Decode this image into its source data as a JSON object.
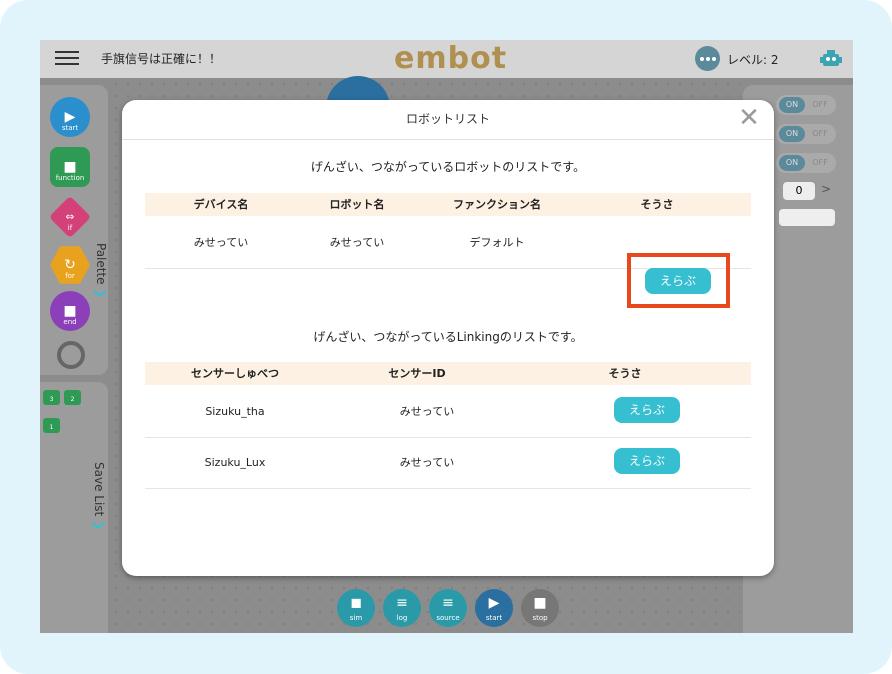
{
  "header": {
    "mission": "手旗信号は正確に！！",
    "logo": "embot",
    "level": "レベル: 2"
  },
  "palette": {
    "tab_label": "Palette",
    "items": [
      {
        "label": "start",
        "color": "#2a8fcc"
      },
      {
        "label": "function",
        "color": "#2e9a54"
      },
      {
        "label": "if",
        "color": "#d4417a"
      },
      {
        "label": "for",
        "color": "#e8a21e"
      },
      {
        "label": "end",
        "color": "#8b3fb8"
      }
    ]
  },
  "save_list": {
    "tab_label": "Save List",
    "slots": [
      "3",
      "2",
      "1"
    ]
  },
  "right_panel": {
    "toggles": [
      {
        "on": "ON",
        "off": "OFF"
      },
      {
        "on": "ON",
        "off": "OFF"
      },
      {
        "on": "ON",
        "off": "OFF"
      }
    ],
    "counter_value": "0",
    "counter_arrow": ">"
  },
  "toolbar": {
    "sim": "sim",
    "log": "log",
    "source": "source",
    "start": "start",
    "stop": "stop"
  },
  "modal": {
    "title": "ロボットリスト",
    "robot_caption": "げんざい、つながっているロボットのリストです。",
    "robot_headers": [
      "デバイス名",
      "ロボット名",
      "ファンクション名",
      "そうさ"
    ],
    "robots": [
      {
        "device": "みせってい",
        "robot": "みせってい",
        "function": "デフォルト",
        "action": "えらぶ"
      }
    ],
    "linking_caption": "げんざい、つながっているLinkingのリストです。",
    "linking_headers": [
      "センサーしゅべつ",
      "センサーID",
      "そうさ"
    ],
    "sensors": [
      {
        "type": "Sizuku_tha",
        "id": "みせってい",
        "action": "えらぶ"
      },
      {
        "type": "Sizuku_Lux",
        "id": "みせってい",
        "action": "えらぶ"
      }
    ]
  },
  "colors": {
    "accent": "#36bfd0",
    "highlight": "#e8481e",
    "header_row": "#fdf1e4"
  }
}
